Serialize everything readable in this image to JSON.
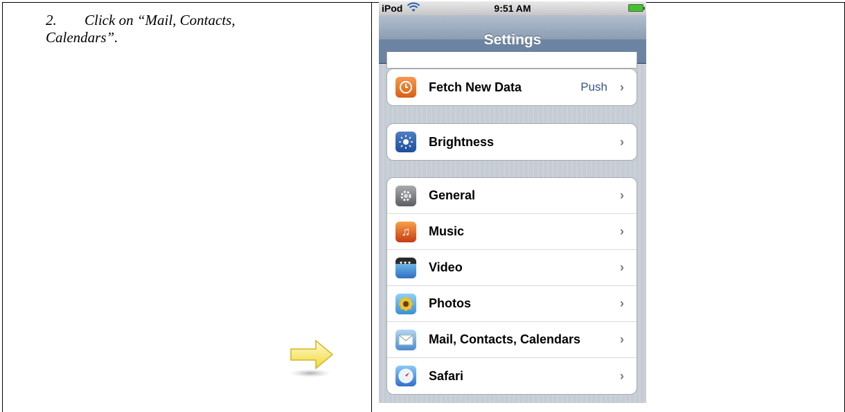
{
  "instruction": {
    "number": "2.",
    "line1": "Click on “Mail, Contacts,",
    "line2": "Calendars”."
  },
  "statusbar": {
    "carrier": "iPod",
    "time": "9:51 AM",
    "wifi_icon": "wifi-icon",
    "battery_icon": "battery-icon"
  },
  "navbar": {
    "title": "Settings"
  },
  "groups": {
    "top": {
      "rows": [
        {
          "label": "Fetch New Data",
          "value": "Push",
          "icon": "clock-icon"
        }
      ]
    },
    "display": {
      "rows": [
        {
          "label": "Brightness",
          "icon": "brightness-icon"
        }
      ]
    },
    "main": {
      "rows": [
        {
          "label": "General",
          "icon": "gear-icon"
        },
        {
          "label": "Music",
          "icon": "music-note-icon"
        },
        {
          "label": "Video",
          "icon": "video-clapper-icon"
        },
        {
          "label": "Photos",
          "icon": "sunflower-icon"
        },
        {
          "label": "Mail, Contacts, Calendars",
          "icon": "mail-envelope-icon"
        },
        {
          "label": "Safari",
          "icon": "compass-icon"
        }
      ]
    }
  },
  "colors": {
    "navbar": "#6d84a2",
    "value_text": "#385487",
    "arrow": "#f5e56a"
  }
}
